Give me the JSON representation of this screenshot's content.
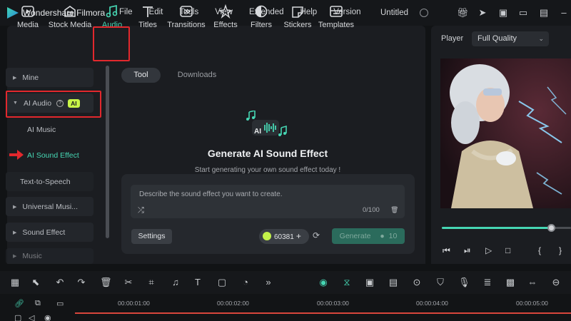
{
  "app": {
    "name": "Wondershare Filmora",
    "project_title": "Untitled"
  },
  "menu": [
    "File",
    "Edit",
    "Tools",
    "View",
    "Extended",
    "Help",
    "Version"
  ],
  "media_tabs": [
    {
      "label": "Media",
      "icon": "media-icon"
    },
    {
      "label": "Stock Media",
      "icon": "stock-media-icon"
    },
    {
      "label": "Audio",
      "icon": "music-note-icon",
      "active": true
    },
    {
      "label": "Titles",
      "icon": "titles-icon"
    },
    {
      "label": "Transitions",
      "icon": "transitions-icon"
    },
    {
      "label": "Effects",
      "icon": "effects-icon"
    },
    {
      "label": "Filters",
      "icon": "filters-icon"
    },
    {
      "label": "Stickers",
      "icon": "stickers-icon"
    },
    {
      "label": "Templates",
      "icon": "templates-icon"
    }
  ],
  "sidebar": {
    "mine": "Mine",
    "ai_audio": "AI Audio",
    "ai_badge": "AI",
    "ai_music": "AI Music",
    "ai_sound_effect": "AI Sound Effect",
    "tts": "Text-to-Speech",
    "universal_music": "Universal Musi...",
    "sound_effect": "Sound Effect",
    "music": "Music"
  },
  "content": {
    "tabs": {
      "tool": "Tool",
      "downloads": "Downloads"
    },
    "title": "Generate AI Sound Effect",
    "subtitle": "Start generating your own sound effect today !",
    "input_placeholder": "Describe the sound effect you want to create.",
    "char_count": "0/100",
    "settings_label": "Settings",
    "credits": "60381",
    "generate_label": "Generate",
    "generate_cost": "10"
  },
  "player": {
    "label": "Player",
    "quality": "Full Quality",
    "progress": 0.85
  },
  "timeline": {
    "ticks": [
      "00:00:01:00",
      "00:00:02:00",
      "00:00:03:00",
      "00:00:04:00",
      "00:00:05:00"
    ]
  },
  "colors": {
    "accent": "#46d6b3",
    "highlight": "#e2282d",
    "ai_badge": "#c8f547",
    "playhead": "#d9463c"
  }
}
